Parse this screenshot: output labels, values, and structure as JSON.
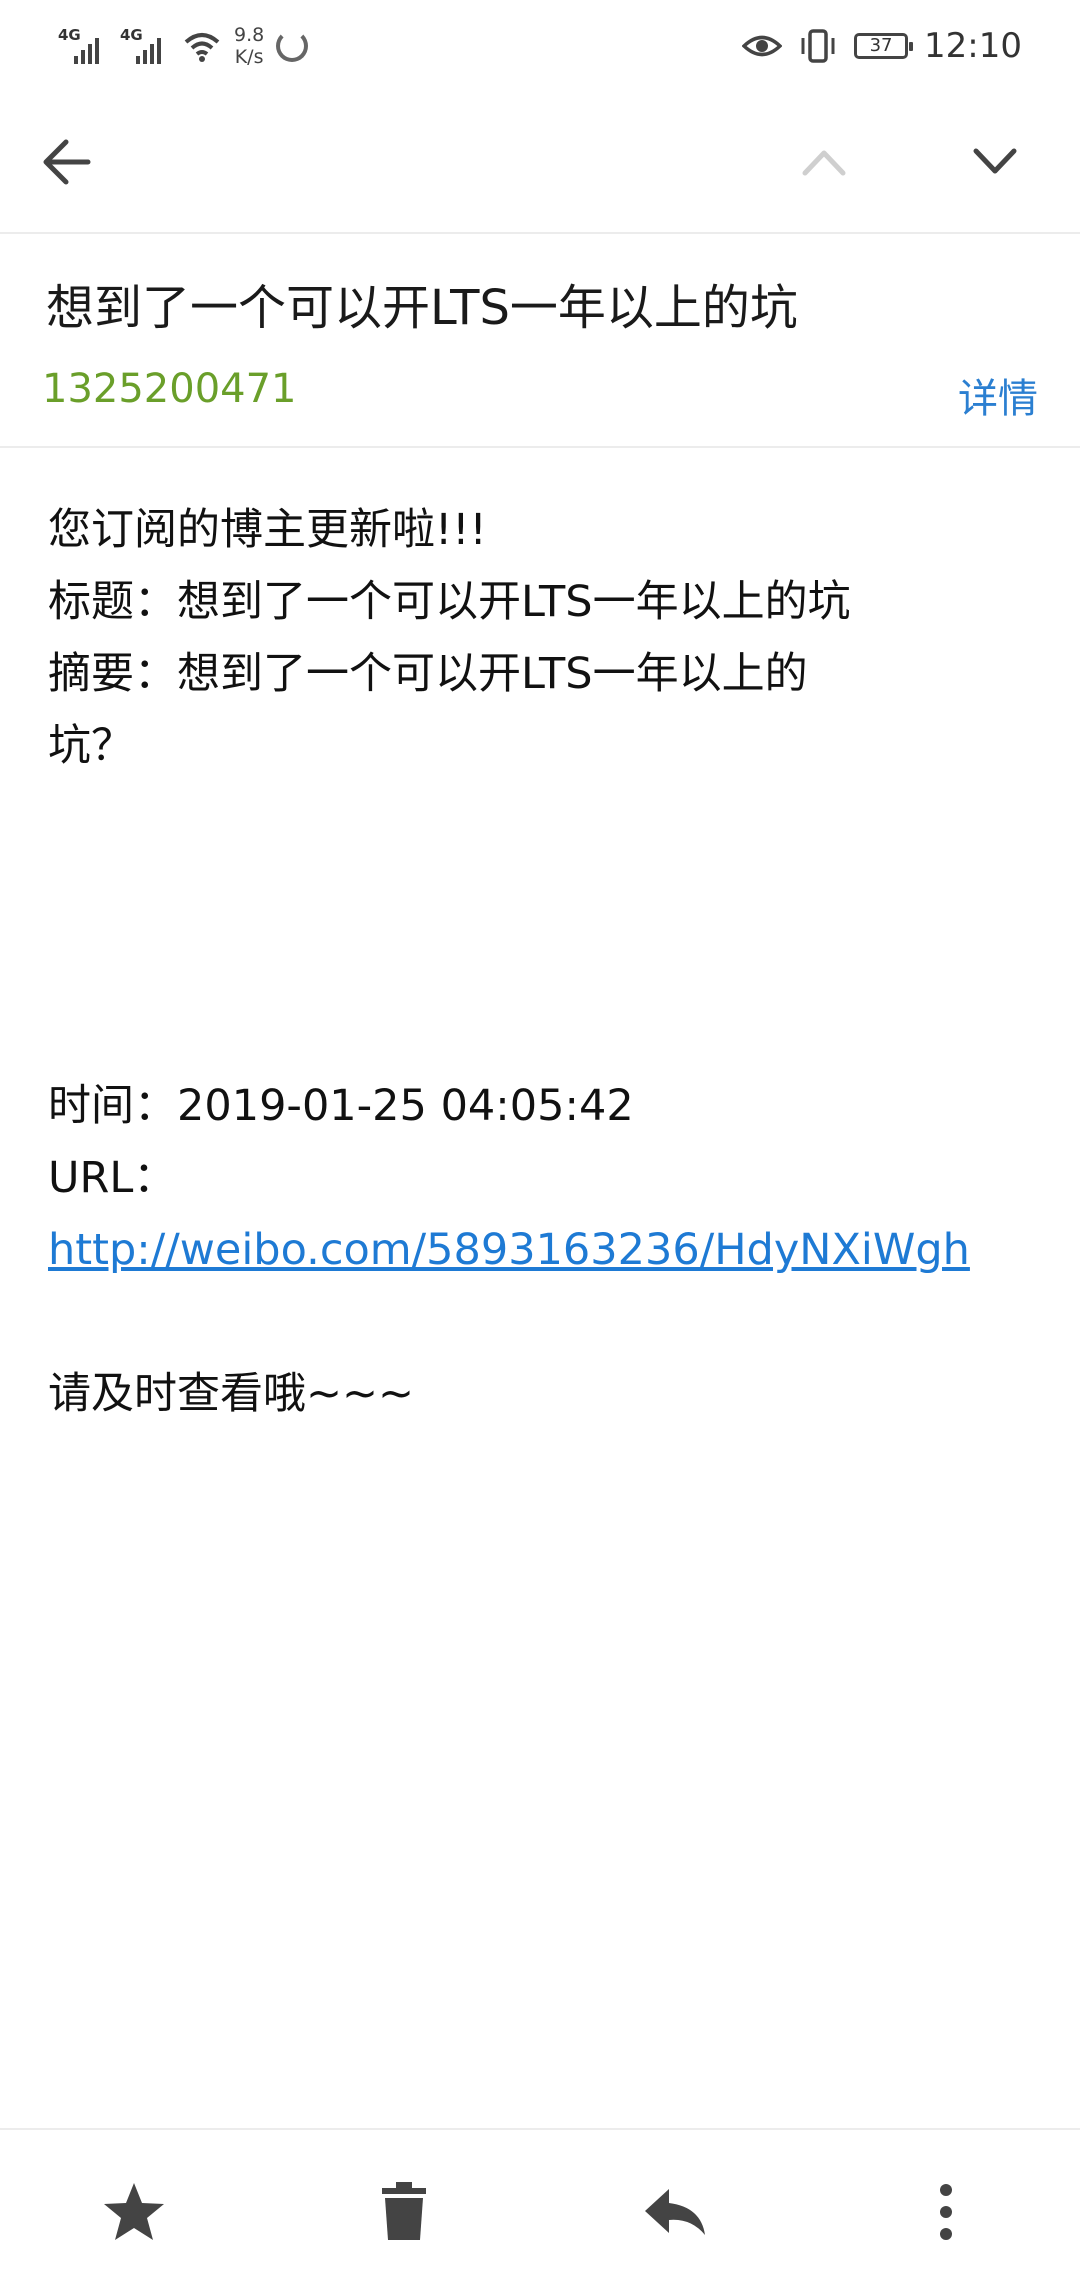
{
  "status_bar": {
    "network1": "4G",
    "network2": "4G",
    "speed_value": "9.8",
    "speed_unit": "K/s",
    "battery": "37",
    "time": "12:10"
  },
  "toolbar": {
    "back_icon": "arrow-left-icon",
    "prev_icon": "chevron-up-icon",
    "next_icon": "chevron-down-icon"
  },
  "email": {
    "subject": "想到了一个可以开LTS一年以上的坑",
    "sender": "1325200471",
    "details_label": "详情",
    "body": {
      "line1": "您订阅的博主更新啦!!!",
      "line2": "标题：想到了一个可以开LTS一年以上的坑",
      "line3": "摘要：想到了一个可以开LTS一年以上的",
      "line4": "坑？",
      "time_line": "时间：2019-01-25 04:05:42",
      "url_label": "URL：",
      "url": "http://weibo.com/5893163236/HdyNXiWgh",
      "closing": "请及时查看哦~~~"
    }
  },
  "bottom_bar": {
    "star_icon": "star-icon",
    "delete_icon": "trash-icon",
    "reply_icon": "reply-icon",
    "more_icon": "more-vertical-icon"
  },
  "colors": {
    "sender": "#6a9f2a",
    "link": "#1e7ad4",
    "details": "#2b7fd1"
  }
}
